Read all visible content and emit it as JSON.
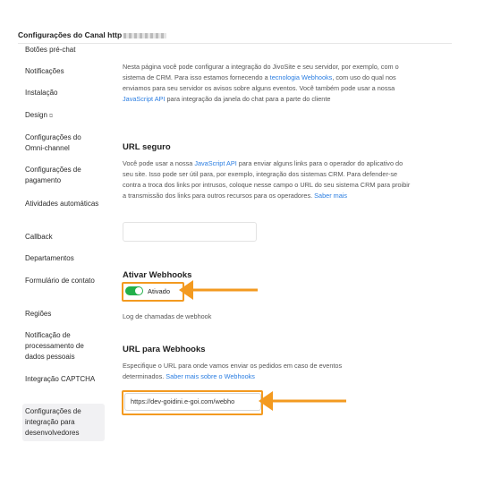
{
  "header": {
    "title": "Configurações do Canal http"
  },
  "sidebar": {
    "items": [
      {
        "label": "Botões pré-chat"
      },
      {
        "label": "Notificações"
      },
      {
        "label": "Instalação"
      },
      {
        "label": "Design"
      },
      {
        "label": "Configurações do Omni-channel"
      },
      {
        "label": "Configurações de pagamento"
      },
      {
        "label": "Atividades automáticas"
      },
      {
        "label": "Callback"
      },
      {
        "label": "Departamentos"
      },
      {
        "label": "Formulário de contato"
      },
      {
        "label": "Regiões"
      },
      {
        "label": "Notificação de processamento de dados pessoais"
      },
      {
        "label": "Integração CAPTCHA"
      },
      {
        "label": "Configurações de integração para desenvolvedores"
      }
    ]
  },
  "intro": {
    "text_1": "Nesta página você pode configurar a integração do JivoSite e seu servidor, por exemplo, com o sistema de CRM. Para isso estamos fornecendo a ",
    "link_1": "tecnologia Webhooks",
    "text_2": ", com uso do qual nos enviamos para seu servidor os avisos sobre alguns eventos. Você também pode usar a nossa ",
    "link_2": "JavaScript API",
    "text_3": " para integração da janela do chat para a parte do cliente"
  },
  "secure_url": {
    "heading": "URL seguro",
    "text_1": "Você pode usar a nossa ",
    "link_1": "JavaScript API",
    "text_2": " para enviar alguns links para o operador do aplicativo do seu site. Isso pode ser útil para, por exemplo, integração dos sistemas CRM. Para defender-se contra a troca dos links por intrusos, coloque nesse campo o URL do seu sistema CRM para proibir a transmissão dos links para outros recursos para os operadores. ",
    "link_2": "Saber mais",
    "input_value": ""
  },
  "webhooks": {
    "heading": "Ativar Webhooks",
    "toggle_label": "Ativado",
    "toggle_on": true,
    "log_label": "Log de chamadas de webhook"
  },
  "webhook_url": {
    "heading": "URL para Webhooks",
    "text_1": "Especifique o URL para onde vamos enviar os pedidos em caso de eventos determinados. ",
    "link_1": "Saber mais sobre o Webhooks",
    "input_value": "https://dev-goidini.e-goi.com/webho"
  },
  "colors": {
    "accent": "#2a7de1",
    "toggle_on": "#23b04a",
    "highlight": "#f39a20"
  }
}
